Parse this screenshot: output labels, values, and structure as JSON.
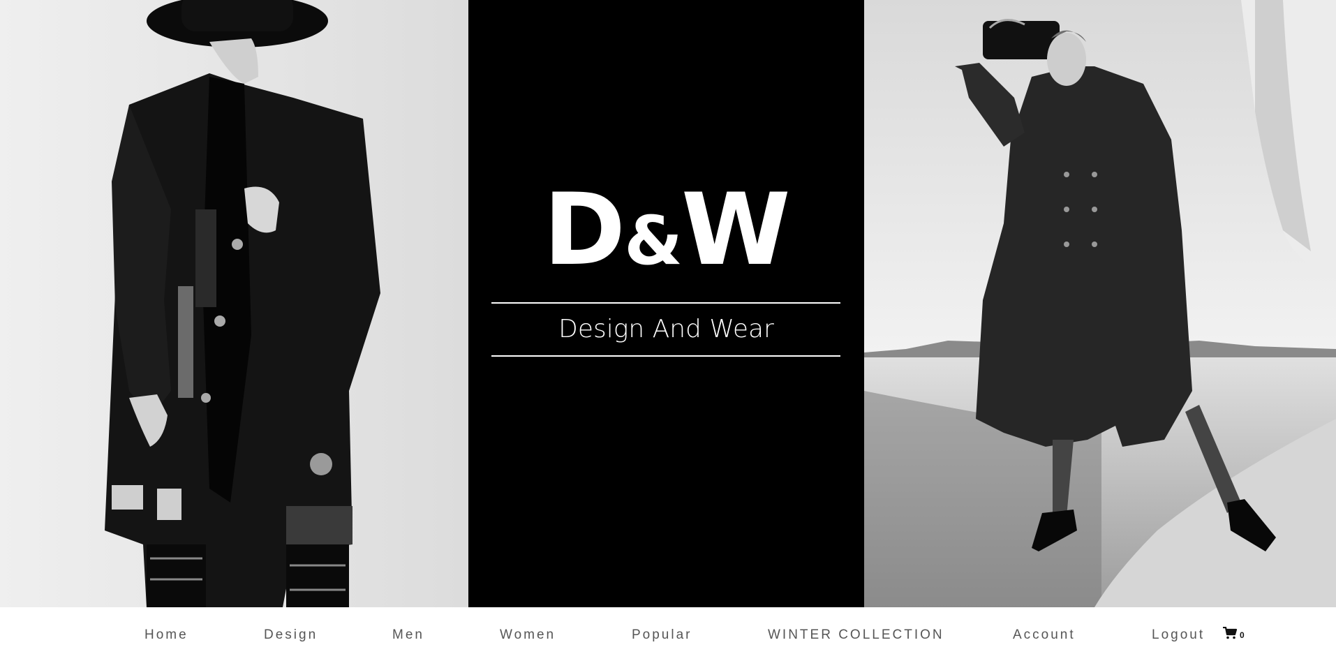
{
  "brand": {
    "logo_left": "D",
    "logo_amp": "&",
    "logo_right": "W",
    "tagline": "Design And Wear"
  },
  "nav": {
    "items": [
      {
        "label": "Home"
      },
      {
        "label": "Design"
      },
      {
        "label": "Men"
      },
      {
        "label": "Women"
      },
      {
        "label": "Popular"
      },
      {
        "label": "WINTER COLLECTION"
      },
      {
        "label": "Account"
      },
      {
        "label": "Logout"
      }
    ],
    "cart": {
      "icon": "cart-icon",
      "count": "0"
    }
  },
  "images": {
    "left_photo": "man-in-black-coat-and-hat-photo",
    "right_photo": "woman-in-long-coat-holding-bag-photo"
  },
  "colors": {
    "center_panel": "#000000",
    "nav_text": "#555555",
    "background": "#ffffff"
  }
}
